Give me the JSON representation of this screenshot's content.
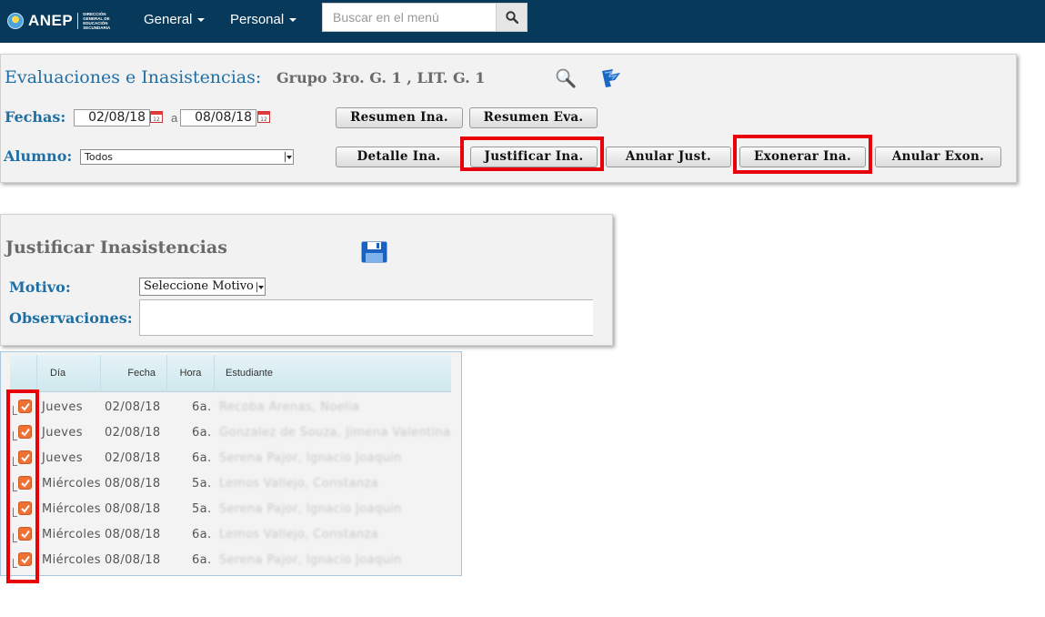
{
  "navbar": {
    "logo_text": "ANEP",
    "logo_subtitle": "DIRECCIÓN GENERAL DE EDUCACIÓN SECUNDARIA",
    "menu": [
      {
        "label": "General"
      },
      {
        "label": "Personal"
      }
    ],
    "search": {
      "placeholder": "Buscar en el menú",
      "icon": "search-icon"
    }
  },
  "evaluaciones": {
    "title": "Evaluaciones e Inasistencias:",
    "group": "Grupo 3ro. G. 1 , LIT. G. 1",
    "icons": [
      "magnifier-icon",
      "flag-refresh-icon"
    ],
    "fechas_label": "Fechas:",
    "date_from": "02/08/18",
    "date_to": "08/08/18",
    "date_sep": "a",
    "alumno_label": "Alumno:",
    "alumno_selected": "Todos",
    "buttons": {
      "resumen_ina": "Resumen Ina.",
      "resumen_eva": "Resumen Eva.",
      "detalle_ina": "Detalle Ina.",
      "justificar_ina": "Justificar Ina.",
      "anular_just": "Anular Just.",
      "exonerar_ina": "Exonerar Ina.",
      "anular_exon": "Anular Exon."
    },
    "highlight_color": "#e8000b"
  },
  "justificar": {
    "title": "Justificar Inasistencias",
    "save_icon": "save-icon",
    "motivo_label": "Motivo:",
    "motivo_selected": "Seleccione Motivo",
    "observaciones_label": "Observaciones:",
    "observaciones_value": ""
  },
  "grid": {
    "columns": {
      "dia": "Día",
      "fecha": "Fecha",
      "hora": "Hora",
      "estudiante": "Estudiante"
    },
    "rows": [
      {
        "checked": true,
        "dia": "Jueves",
        "fecha": "02/08/18",
        "hora": "6a.",
        "estudiante": "Recoba Arenas, Noelia"
      },
      {
        "checked": true,
        "dia": "Jueves",
        "fecha": "02/08/18",
        "hora": "6a.",
        "estudiante": "Gonzalez de Souza, Jimena Valentina"
      },
      {
        "checked": true,
        "dia": "Jueves",
        "fecha": "02/08/18",
        "hora": "6a.",
        "estudiante": "Serena Pajor, Ignacio Joaquin"
      },
      {
        "checked": true,
        "dia": "Miércoles",
        "fecha": "08/08/18",
        "hora": "5a.",
        "estudiante": "Lemos Vallejo, Constanza"
      },
      {
        "checked": true,
        "dia": "Miércoles",
        "fecha": "08/08/18",
        "hora": "5a.",
        "estudiante": "Serena Pajor, Ignacio Joaquin"
      },
      {
        "checked": true,
        "dia": "Miércoles",
        "fecha": "08/08/18",
        "hora": "6a.",
        "estudiante": "Lemos Vallejo, Constanza"
      },
      {
        "checked": true,
        "dia": "Miércoles",
        "fecha": "08/08/18",
        "hora": "6a.",
        "estudiante": "Serena Pajor, Ignacio Joaquin"
      }
    ]
  }
}
